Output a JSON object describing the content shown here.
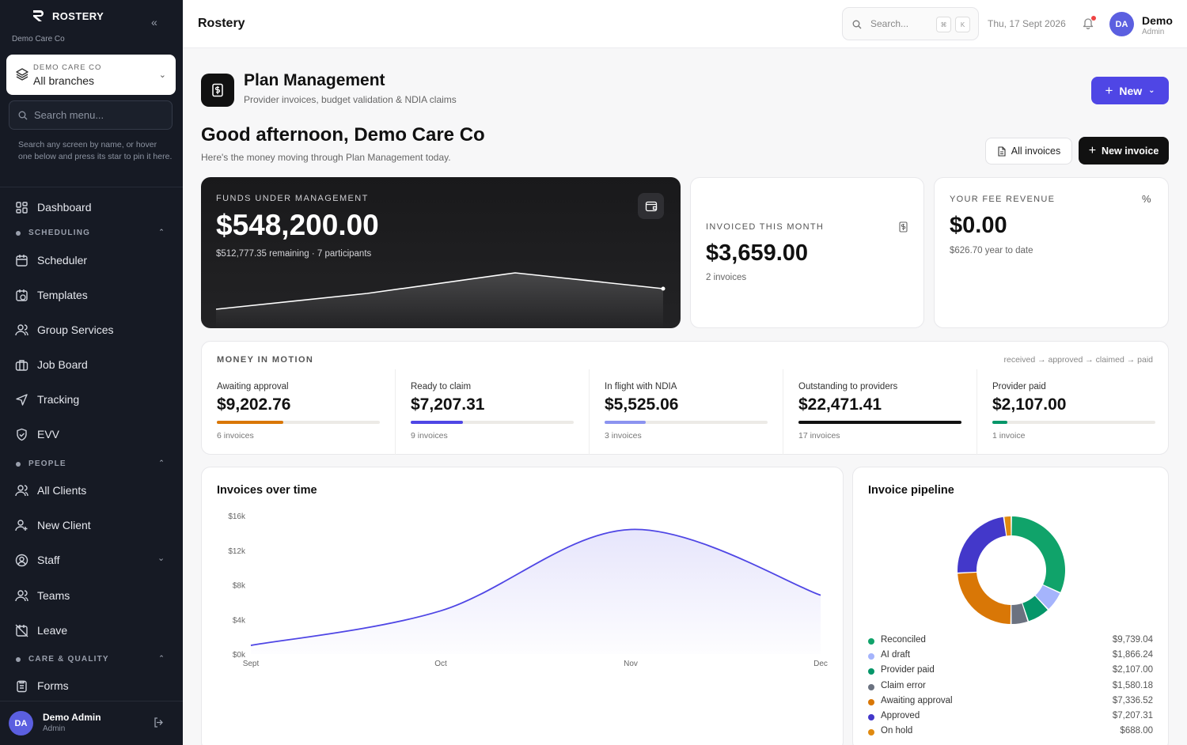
{
  "sidebar": {
    "brand": "ROSTERY",
    "org": "Demo Care Co",
    "branch": {
      "org_label": "DEMO CARE CO",
      "value": "All branches"
    },
    "search_placeholder": "Search menu...",
    "help": "Search any screen by name, or hover one below and press its star to pin it here.",
    "items": [
      {
        "label": "Dashboard",
        "icon": "dashboard-icon"
      },
      {
        "label": "Scheduler",
        "icon": "calendar-icon"
      },
      {
        "label": "Templates",
        "icon": "calendar-clock-icon"
      },
      {
        "label": "Group Services",
        "icon": "users-icon"
      },
      {
        "label": "Job Board",
        "icon": "briefcase-icon"
      },
      {
        "label": "Tracking",
        "icon": "navigation-icon"
      },
      {
        "label": "EVV",
        "icon": "shield-check-icon"
      },
      {
        "label": "All Clients",
        "icon": "users-icon"
      },
      {
        "label": "New Client",
        "icon": "user-plus-icon"
      },
      {
        "label": "Staff",
        "icon": "user-circle-icon"
      },
      {
        "label": "Teams",
        "icon": "users-icon"
      },
      {
        "label": "Leave",
        "icon": "calendar-off-icon"
      },
      {
        "label": "Forms",
        "icon": "clipboard-icon"
      }
    ],
    "sections": {
      "scheduling": "SCHEDULING",
      "people": "PEOPLE",
      "care": "CARE & QUALITY"
    },
    "user": {
      "initials": "DA",
      "name": "Demo Admin",
      "role": "Admin"
    }
  },
  "topbar": {
    "title": "Rostery",
    "search_placeholder": "Search...",
    "kbd1": "⌘",
    "kbd2": "K",
    "date": "Thu, 17 Sept 2026",
    "user": {
      "initials": "DA",
      "name": "Demo",
      "role": "Admin"
    }
  },
  "page": {
    "title": "Plan Management",
    "subtitle": "Provider invoices, budget validation & NDIA claims",
    "new_label": "New",
    "greeting": "Good afternoon, Demo Care Co",
    "greeting_sub": "Here's the money moving through Plan Management today.",
    "all_invoices": "All invoices",
    "new_invoice": "New invoice"
  },
  "kpis": {
    "funds": {
      "label": "FUNDS UNDER MANAGEMENT",
      "value": "$548,200.00",
      "sub": "$512,777.35 remaining · 7 participants"
    },
    "invoiced": {
      "label": "INVOICED THIS MONTH",
      "value": "$3,659.00",
      "sub": "2 invoices"
    },
    "fee": {
      "label": "YOUR FEE REVENUE",
      "value": "$0.00",
      "sub": "$626.70 year to date"
    }
  },
  "money_in_motion": {
    "label": "MONEY IN MOTION",
    "flow": "received → approved → claimed → paid",
    "stages": [
      {
        "name": "Awaiting approval",
        "value": "$9,202.76",
        "count": "6 invoices",
        "share": 0.41,
        "color": "#d97706"
      },
      {
        "name": "Ready to claim",
        "value": "$7,207.31",
        "count": "9 invoices",
        "share": 0.32,
        "color": "#4f46e5"
      },
      {
        "name": "In flight with NDIA",
        "value": "$5,525.06",
        "count": "3 invoices",
        "share": 0.25,
        "color": "#8b93f0"
      },
      {
        "name": "Outstanding to providers",
        "value": "$22,471.41",
        "count": "17 invoices",
        "share": 1.0,
        "color": "#111111"
      },
      {
        "name": "Provider paid",
        "value": "$2,107.00",
        "count": "1 invoice",
        "share": 0.09,
        "color": "#059669"
      }
    ]
  },
  "invoices_over_time": {
    "title": "Invoices over time",
    "chart_data": {
      "type": "area",
      "x": [
        "Sept",
        "Oct",
        "Nov",
        "Dec"
      ],
      "values": [
        1000,
        5000,
        14400,
        6800
      ],
      "y_ticks": [
        "$0k",
        "$4k",
        "$8k",
        "$12k",
        "$16k"
      ],
      "ylim": [
        0,
        16000
      ],
      "color": "#4f46e5"
    }
  },
  "pipeline": {
    "title": "Invoice pipeline",
    "chart_data": {
      "type": "pie",
      "labels": [
        "Reconciled",
        "AI draft",
        "Provider paid",
        "Claim error",
        "Awaiting approval",
        "Approved",
        "On hold"
      ],
      "amounts": [
        "$9,739.04",
        "$1,866.24",
        "$2,107.00",
        "$1,580.18",
        "$7,336.52",
        "$7,207.31",
        "$688.00"
      ],
      "values": [
        9739.04,
        1866.24,
        2107.0,
        1580.18,
        7336.52,
        7207.31,
        688.0
      ],
      "colors": [
        "#10a36a",
        "#a5b4fc",
        "#059669",
        "#6b7280",
        "#d97706",
        "#4338ca",
        "#e08a10"
      ]
    }
  }
}
